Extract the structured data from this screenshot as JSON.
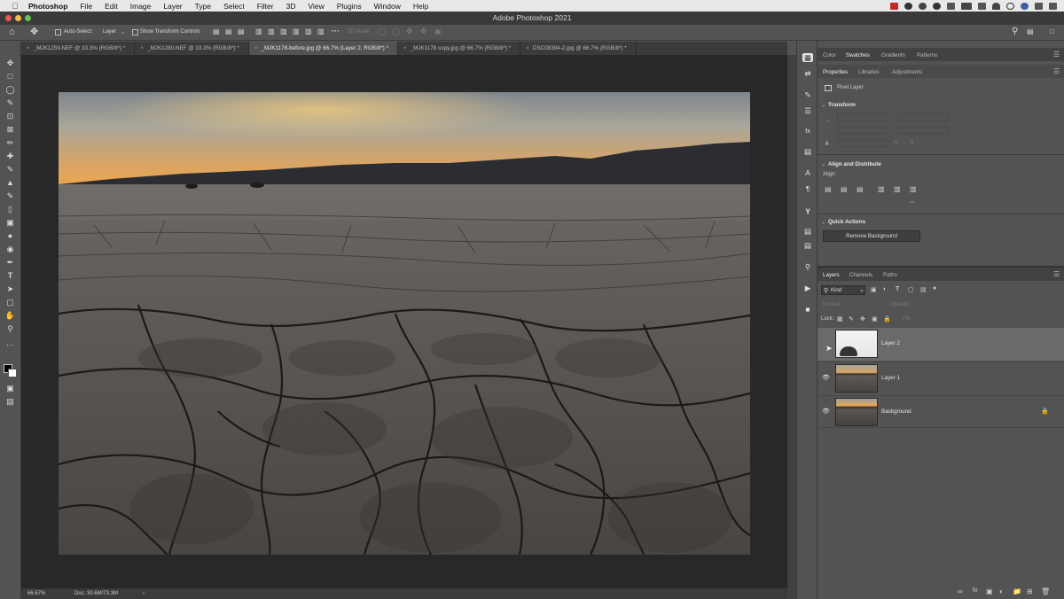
{
  "menubar": {
    "app": "Photoshop",
    "items": [
      "File",
      "Edit",
      "Image",
      "Layer",
      "Type",
      "Select",
      "Filter",
      "3D",
      "View",
      "Plugins",
      "Window",
      "Help"
    ]
  },
  "window_title": "Adobe Photoshop 2021",
  "options": {
    "auto_select_label": "Auto-Select:",
    "auto_select_value": "Layer",
    "transform_controls_label": "Show Transform Controls",
    "mode_3d": "3D Mode:"
  },
  "tabs": [
    {
      "label": "_MJK1259.NEF @ 33.3% (RGB/8*) *",
      "active": false
    },
    {
      "label": "_MJK1280.NEF @ 33.3% (RGB/8*) *",
      "active": false
    },
    {
      "label": "_MJK1178-before.jpg @ 66.7% (Layer 2, RGB/8*) *",
      "active": true
    },
    {
      "label": "_MJK1178 copy.jpg @ 66.7% (RGB/8*) *",
      "active": false
    },
    {
      "label": "DSC08384-2.jpg @ 66.7% (RGB/8*) *",
      "active": false
    }
  ],
  "status": {
    "zoom": "66.67%",
    "doc": "Doc: 30.6M/73.3M"
  },
  "upper_panel": {
    "tabs": [
      "Color",
      "Swatches",
      "Gradients",
      "Patterns"
    ],
    "active_tab": "Swatches",
    "subtabs": [
      "Properties",
      "Libraries",
      "Adjustments"
    ],
    "active_subtab": "Properties",
    "layer_type": "Pixel Layer",
    "transform_title": "Transform",
    "align_title": "Align and Distribute",
    "align_label": "Align:",
    "quick_actions_title": "Quick Actions",
    "remove_bg_button": "Remove Background"
  },
  "layers_panel": {
    "tabs": [
      "Layers",
      "Channels",
      "Paths"
    ],
    "active_tab": "Layers",
    "filter_kind": "Kind",
    "blend_mode": "Normal",
    "opacity_label": "Opacity:",
    "lock_label": "Lock:",
    "fill_label": "Fill:",
    "layers": [
      {
        "name": "Layer 2",
        "visible": false,
        "selected": true
      },
      {
        "name": "Layer 1",
        "visible": true,
        "selected": false
      },
      {
        "name": "Background",
        "visible": true,
        "selected": false,
        "locked": true
      }
    ]
  },
  "colors": {
    "ui_bg": "#535353",
    "canvas_bg": "#282828",
    "sky_top": "#8a8f93",
    "sky_glow": "#e9a24a"
  }
}
